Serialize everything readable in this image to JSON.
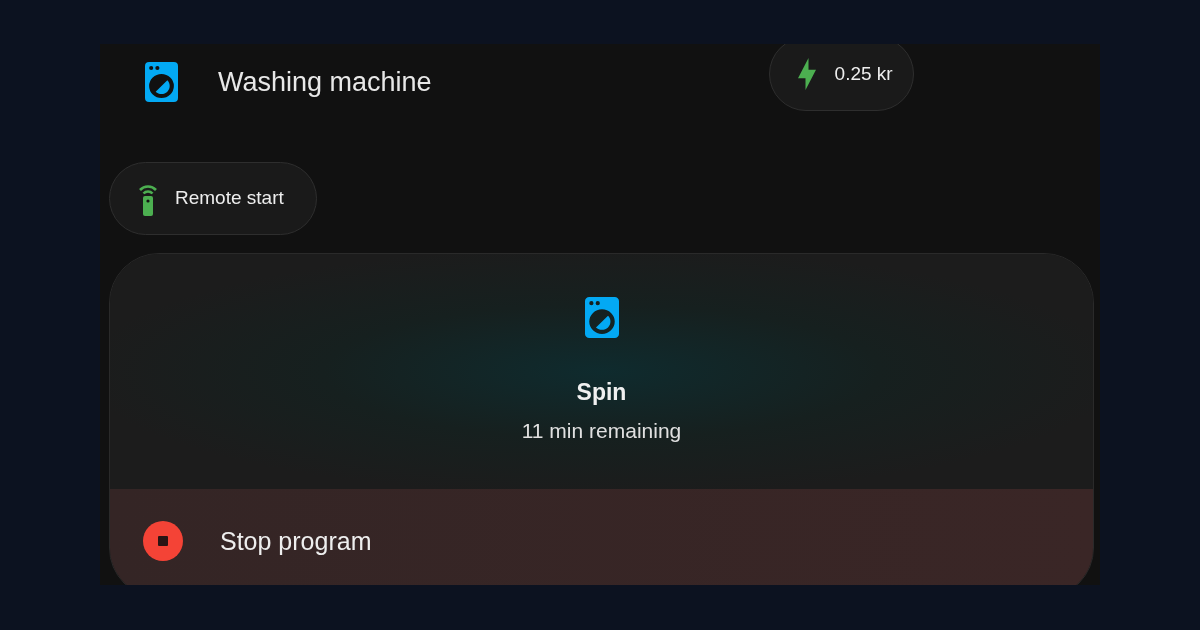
{
  "header": {
    "title": "Washing machine",
    "cost_badge": "0.25 kr"
  },
  "remote_start": {
    "label": "Remote start"
  },
  "status": {
    "program": "Spin",
    "remaining": "11 min remaining"
  },
  "action": {
    "label": "Stop program"
  }
}
